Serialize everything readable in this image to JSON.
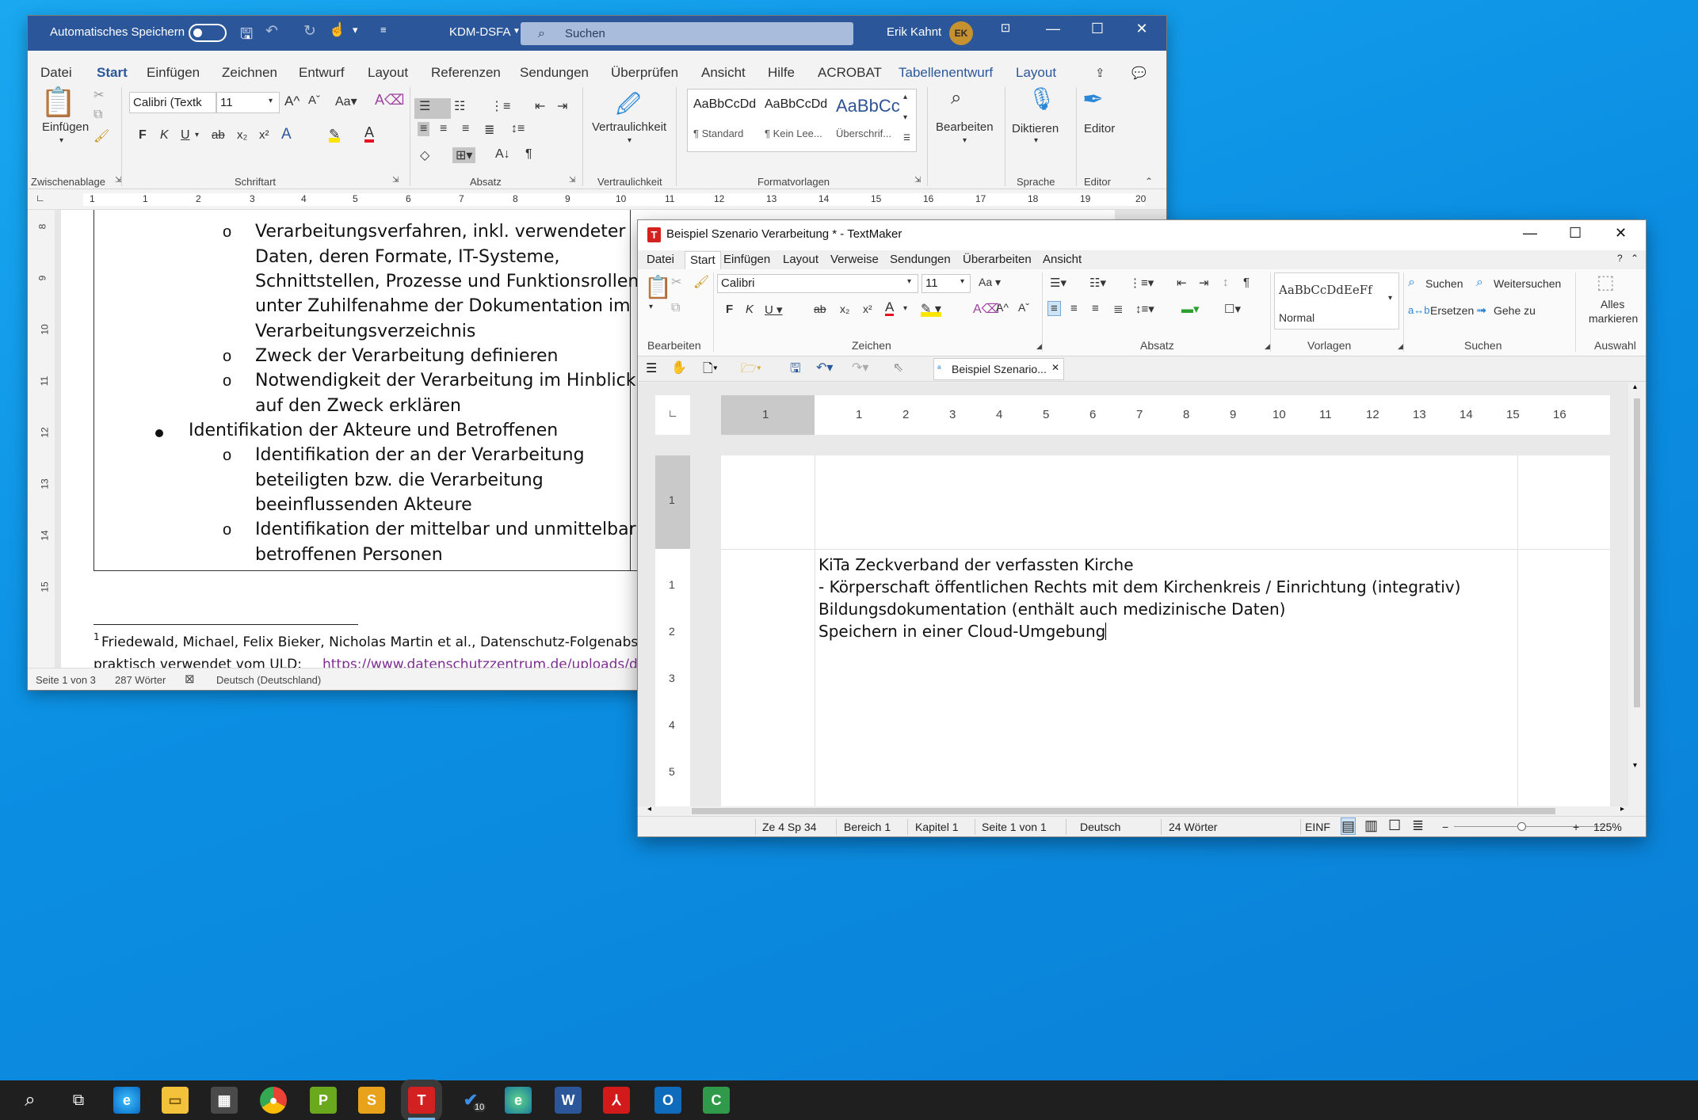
{
  "word": {
    "title_bar": {
      "autosave_label": "Automatisches Speichern",
      "doc_name": "KDM-DSFA",
      "search_placeholder": "Suchen",
      "user_name": "Erik Kahnt",
      "user_initials": "EK"
    },
    "menu": [
      "Datei",
      "Start",
      "Einfügen",
      "Zeichnen",
      "Entwurf",
      "Layout",
      "Referenzen",
      "Sendungen",
      "Überprüfen",
      "Ansicht",
      "Hilfe",
      "ACROBAT",
      "Tabellenentwurf",
      "Layout"
    ],
    "active_menu": "Start",
    "ribbon": {
      "paste_label": "Einfügen",
      "font_name": "Calibri (Textk",
      "font_size": "11",
      "style_samples": [
        "AaBbCcDd",
        "AaBbCcDd",
        "AaBbCc"
      ],
      "style_names": [
        "¶ Standard",
        "¶ Kein Lee...",
        "Überschrif..."
      ],
      "vertraulichkeit_label": "Vertraulichkeit",
      "bearbeiten_label": "Bearbeiten",
      "diktieren_label": "Diktieren",
      "editor_label": "Editor",
      "groups": [
        "Zwischenablage",
        "Schriftart",
        "Absatz",
        "Vertraulichkeit",
        "Formatvorlagen",
        "Sprache",
        "Editor"
      ]
    },
    "ruler_numbers": [
      "1",
      "2",
      "1",
      "2",
      "3",
      "4",
      "5",
      "6",
      "7",
      "8",
      "9",
      "10",
      "11",
      "12",
      "13",
      "14",
      "15",
      "16",
      "17",
      "18",
      "19",
      "20"
    ],
    "vruler_numbers": [
      "8",
      "9",
      "10",
      "11",
      "12",
      "13",
      "14",
      "15"
    ],
    "doc_lines": [
      "Verarbeitungsverfahren, inkl. verwendeter",
      "Daten, deren Formate, IT-Systeme,",
      "Schnittstellen, Prozesse und Funktionsrollen",
      "unter Zuhilfenahme der Dokumentation im",
      "Verarbeitungsverzeichnis",
      "Zweck der Verarbeitung definieren",
      "Notwendigkeit der Verarbeitung im Hinblick",
      "auf den Zweck erklären",
      "Identifikation der Akteure und Betroffenen",
      "Identifikation der an der Verarbeitung",
      "beteiligten bzw. die Verarbeitung",
      "beeinflussenden Akteure",
      "Identifikation der mittelbar und unmittelbar",
      "betroffenen Personen"
    ],
    "footnote": "Friedewald, Michael, Felix Bieker, Nicholas Martin et al., Datenschutz-Folgenabsc",
    "footnote_mark": "1",
    "footnote_line2_prefix": "praktisch verwendet vom ULD: ",
    "footnote_link": "https://www.datenschutzzentrum.de/uploads/dat",
    "status": {
      "page": "Seite 1 von 3",
      "words": "287 Wörter",
      "language": "Deutsch (Deutschland)"
    }
  },
  "textmaker": {
    "title": "Beispiel Szenario Verarbeitung * - TextMaker",
    "menu": [
      "Datei",
      "Start",
      "Einfügen",
      "Layout",
      "Verweise",
      "Sendungen",
      "Überarbeiten",
      "Ansicht"
    ],
    "active_menu": "Start",
    "ribbon": {
      "font_name": "Calibri",
      "font_size": "11",
      "style_sample": "AaBbCcDdEeFf",
      "style_name": "Normal",
      "suchen": "Suchen",
      "weitersuchen": "Weitersuchen",
      "ersetzen": "Ersetzen",
      "gehe_zu": "Gehe zu",
      "alles_markieren_1": "Alles",
      "alles_markieren_2": "markieren",
      "groups": [
        "Bearbeiten",
        "Zeichen",
        "Absatz",
        "Vorlagen",
        "Suchen",
        "Auswahl"
      ]
    },
    "doc_tab": "Beispiel Szenario...",
    "hruler_numbers": [
      "1",
      "1",
      "2",
      "3",
      "4",
      "5",
      "6",
      "7",
      "8",
      "9",
      "10",
      "11",
      "12",
      "13",
      "14",
      "15",
      "16"
    ],
    "vruler_numbers": [
      "1",
      "1",
      "2",
      "3",
      "4",
      "5"
    ],
    "lines": [
      "KiTa Zeckverband der verfassten Kirche",
      "- Körperschaft öffentlichen Rechts mit dem Kirchenkreis / Einrichtung (integrativ)",
      "Bildungsdokumentation (enthält auch medizinische Daten)",
      "Speichern in einer Cloud-Umgebung"
    ],
    "status": {
      "position": "Ze 4 Sp 34",
      "bereich": "Bereich 1",
      "kapitel": "Kapitel 1",
      "seite": "Seite 1 von 1",
      "sprache": "Deutsch",
      "woerter": "24 Wörter",
      "mode": "EINF",
      "zoom": "125%"
    }
  },
  "taskbar": {
    "apps": [
      "search-icon",
      "task-view-icon",
      "edge-icon",
      "file-explorer-icon",
      "calculator-icon",
      "chrome-icon",
      "planmaker-icon",
      "presentations-icon",
      "textmaker-icon",
      "todo-icon",
      "edge-dev-icon",
      "word-icon",
      "acrobat-icon",
      "outlook-icon",
      "camtasia-icon"
    ],
    "todo_badge": "10"
  }
}
